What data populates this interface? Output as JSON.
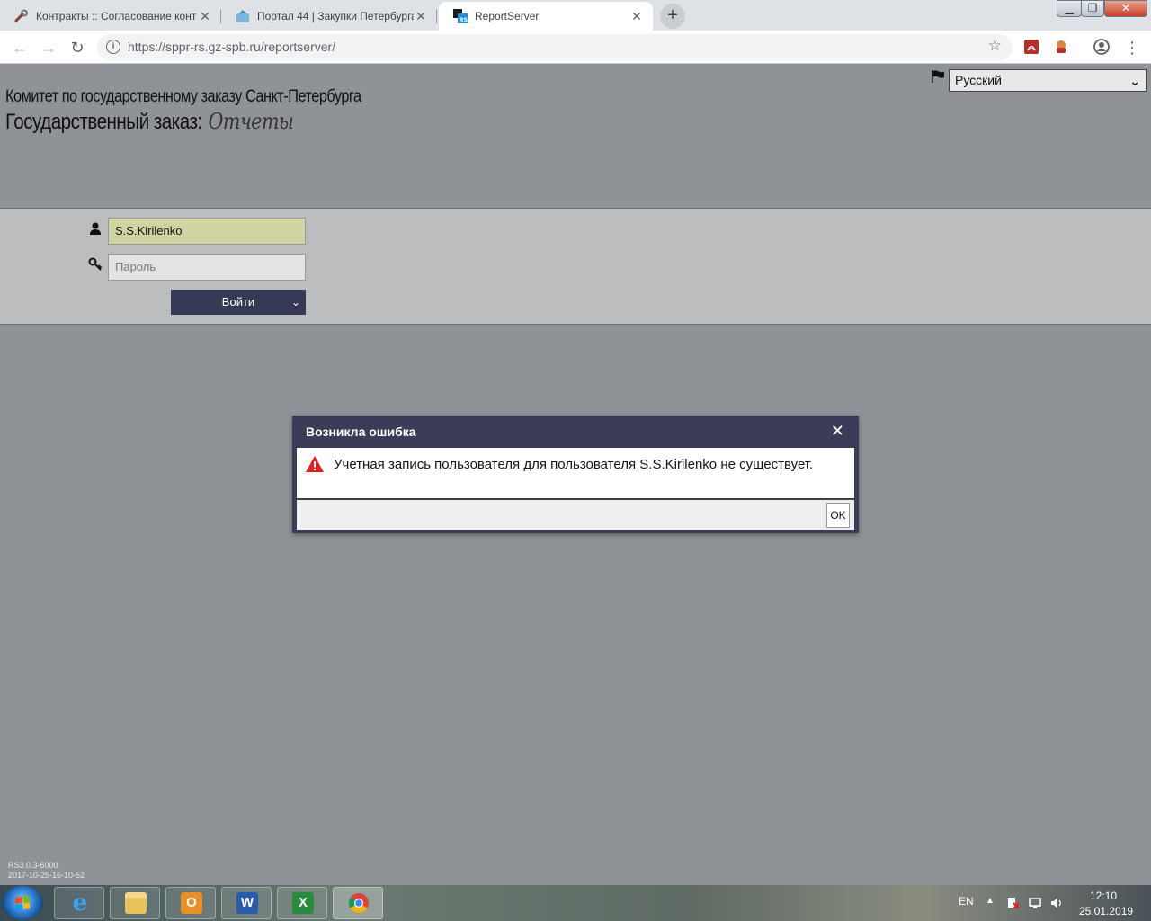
{
  "browser": {
    "tabs": [
      {
        "title": "Контракты :: Согласование конт",
        "active": false
      },
      {
        "title": "Портал 44 | Закупки Петербурга",
        "active": false
      },
      {
        "title": "ReportServer",
        "active": true
      }
    ],
    "url": "https://sppr-rs.gz-spb.ru/reportserver/",
    "new_tab_glyph": "+",
    "close_glyph": "✕"
  },
  "header": {
    "organization": "Комитет по государственному заказу Санкт-Петербурга",
    "title": "Государственный заказ:",
    "title_script": "Отчеты",
    "language": {
      "selected": "Русский"
    }
  },
  "login": {
    "username_value": "S.S.Kirilenko",
    "password_placeholder": "Пароль",
    "submit_label": "Войти"
  },
  "version": {
    "line1": "RS3.0.3-6000",
    "line2": "2017-10-25-16-10-52"
  },
  "dialog": {
    "title": "Возникла ошибка",
    "message": "Учетная запись пользователя для пользователя S.S.Kirilenko не существует.",
    "ok_label": "OK",
    "close_glyph": "✕"
  },
  "taskbar": {
    "apps": [
      "internet-explorer",
      "file-explorer",
      "outlook",
      "word",
      "excel",
      "chrome"
    ],
    "language": "EN",
    "time": "12:10",
    "date": "25.01.2019"
  },
  "colors": {
    "page_bg": "#8f9397",
    "login_band": "#bcbdbf",
    "dialog_header": "#3b3c58",
    "login_button": "#373a55",
    "username_field": "#cfd4a2",
    "warning_red": "#e02020"
  }
}
